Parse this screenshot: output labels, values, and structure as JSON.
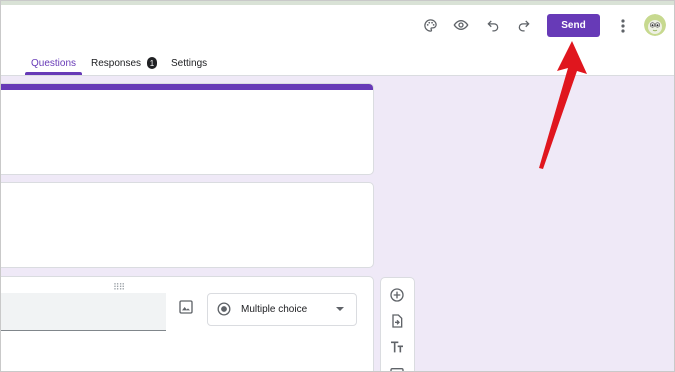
{
  "header": {
    "toolbar_icons": [
      "palette-icon",
      "eye-icon",
      "undo-icon",
      "redo-icon"
    ],
    "send_label": "Send",
    "more_icon": "more-vert-icon",
    "avatar_icon": "avatar"
  },
  "tabs": [
    {
      "label": "Questions",
      "active": true
    },
    {
      "label": "Responses",
      "badge": "1"
    },
    {
      "label": "Settings"
    }
  ],
  "question": {
    "type_label": "Multiple choice",
    "type_icon": "radio-button-icon",
    "image_icon": "image-icon"
  },
  "side_toolbar": [
    "add-circle-icon",
    "import-questions-icon",
    "title-text-icon"
  ],
  "colors": {
    "accent": "#673ab7",
    "background": "#efe9f7",
    "annotation_arrow": "#e0161e"
  }
}
